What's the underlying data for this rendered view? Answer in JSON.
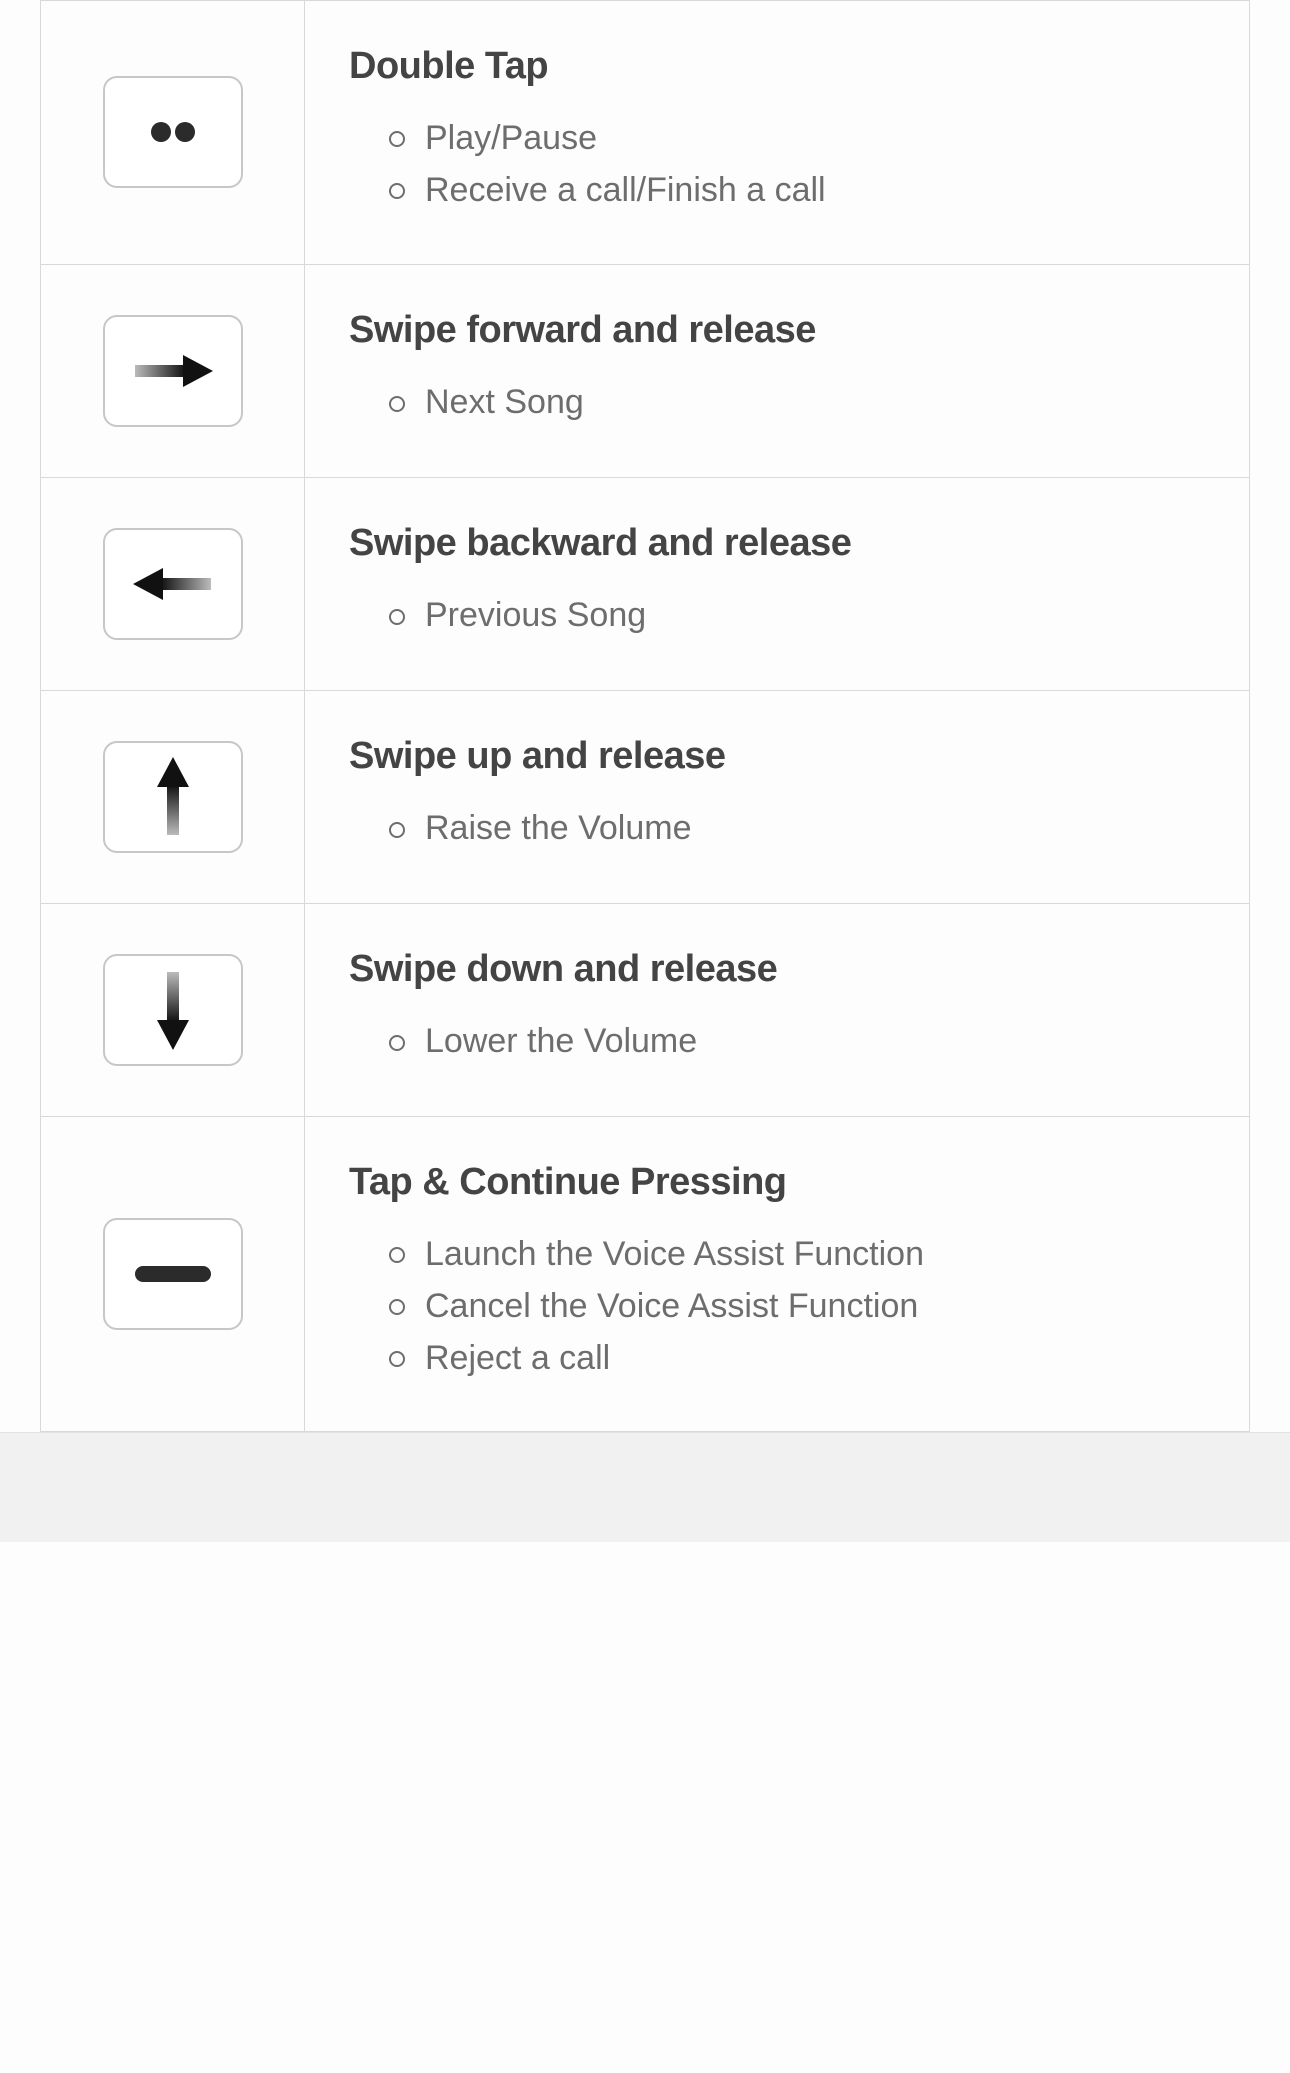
{
  "gestures": [
    {
      "icon": "double-tap-icon",
      "title": "Double Tap",
      "actions": [
        "Play/Pause",
        "Receive a call/Finish a call"
      ]
    },
    {
      "icon": "swipe-forward-icon",
      "title": "Swipe forward and release",
      "actions": [
        "Next Song"
      ]
    },
    {
      "icon": "swipe-backward-icon",
      "title": "Swipe backward and release",
      "actions": [
        "Previous Song"
      ]
    },
    {
      "icon": "swipe-up-icon",
      "title": "Swipe up and release",
      "actions": [
        "Raise the Volume"
      ]
    },
    {
      "icon": "swipe-down-icon",
      "title": "Swipe down and release",
      "actions": [
        "Lower the Volume"
      ]
    },
    {
      "icon": "tap-hold-icon",
      "title": "Tap & Continue Pressing",
      "actions": [
        "Launch the Voice Assist Function",
        "Cancel the Voice Assist Function",
        "Reject a call"
      ]
    }
  ]
}
